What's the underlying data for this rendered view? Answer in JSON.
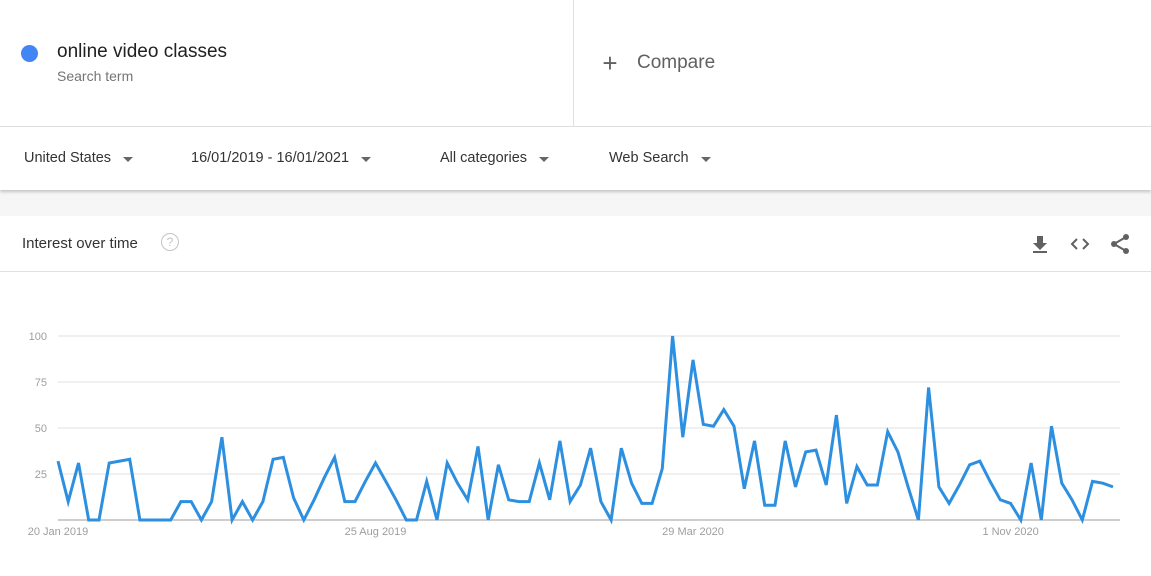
{
  "search_term": {
    "name": "online video classes",
    "subtitle": "Search term",
    "color": "#4285f4"
  },
  "compare": {
    "label": "Compare",
    "icon": "plus-icon"
  },
  "filters": {
    "region": "United States",
    "date_range": "16/01/2019 - 16/01/2021",
    "category": "All categories",
    "search_type": "Web Search"
  },
  "card": {
    "title": "Interest over time",
    "help_icon": "?",
    "actions": [
      "download-icon",
      "embed-icon",
      "share-icon"
    ]
  },
  "chart_data": {
    "type": "line",
    "title": "Interest over time",
    "xlabel": "",
    "ylabel": "",
    "ylim": [
      0,
      100
    ],
    "yticks": [
      25,
      50,
      75,
      100
    ],
    "grid": true,
    "legend": "none",
    "line_color": "#2d8fe0",
    "x_tick_labels": [
      {
        "label": "20 Jan 2019",
        "index": 0
      },
      {
        "label": "25 Aug 2019",
        "index": 31
      },
      {
        "label": "29 Mar 2020",
        "index": 62
      },
      {
        "label": "1 Nov 2020",
        "index": 93
      }
    ],
    "series": [
      {
        "name": "online video classes",
        "values": [
          32,
          10,
          31,
          0,
          0,
          31,
          32,
          33,
          0,
          0,
          0,
          0,
          10,
          10,
          0,
          10,
          45,
          0,
          10,
          0,
          10,
          33,
          34,
          12,
          0,
          11,
          23,
          34,
          10,
          10,
          21,
          31,
          21,
          11,
          0,
          0,
          21,
          0,
          31,
          20,
          11,
          40,
          0,
          30,
          11,
          10,
          10,
          31,
          11,
          43,
          10,
          19,
          39,
          10,
          0,
          39,
          20,
          9,
          9,
          28,
          100,
          45,
          87,
          52,
          51,
          60,
          51,
          17,
          43,
          8,
          8,
          43,
          18,
          37,
          38,
          19,
          57,
          9,
          29,
          19,
          19,
          48,
          37,
          18,
          0,
          72,
          18,
          9,
          19,
          30,
          32,
          21,
          11,
          9,
          0,
          31,
          0,
          51,
          20,
          11,
          0,
          21,
          20,
          18
        ]
      }
    ]
  }
}
